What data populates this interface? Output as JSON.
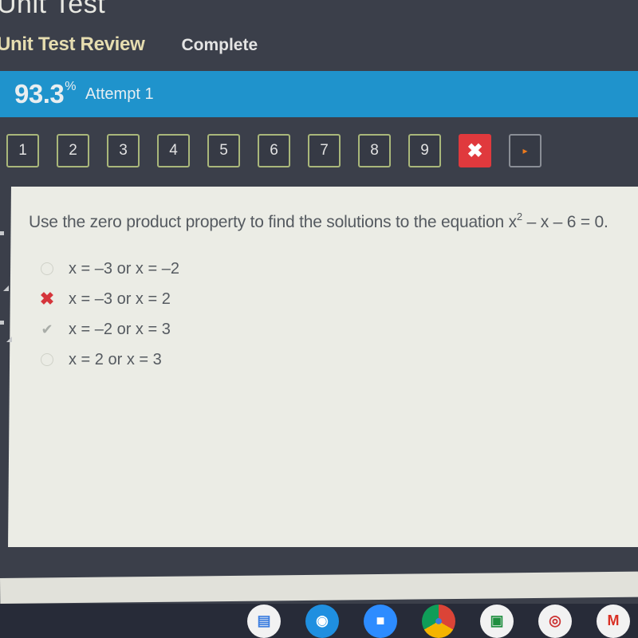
{
  "header": {
    "title": "Unit Test",
    "subnav": {
      "review": "Unit Test Review",
      "status": "Complete"
    }
  },
  "score_bar": {
    "score": "93.3",
    "percent_sign": "%",
    "attempt": "Attempt 1",
    "color": "#1f93cc"
  },
  "question_nav": {
    "items": [
      {
        "label": "1",
        "state": "answered"
      },
      {
        "label": "2",
        "state": "answered"
      },
      {
        "label": "3",
        "state": "answered"
      },
      {
        "label": "4",
        "state": "answered"
      },
      {
        "label": "5",
        "state": "answered"
      },
      {
        "label": "6",
        "state": "answered"
      },
      {
        "label": "7",
        "state": "answered"
      },
      {
        "label": "8",
        "state": "answered"
      },
      {
        "label": "9",
        "state": "answered"
      },
      {
        "label": "✖",
        "state": "incorrect",
        "icon": "x-icon"
      },
      {
        "label": "▸",
        "state": "next",
        "icon": "play-arrow-icon"
      }
    ],
    "answered_border": "#a9b77a",
    "incorrect_color": "#e0393d"
  },
  "question": {
    "prefix": "Use the zero product property to find the solutions to the equation x",
    "exponent": "2",
    "suffix": " – x – 6 = 0.",
    "choices": [
      {
        "text": "x = –3 or x = –2",
        "mark": "radio-icon",
        "glyph": ""
      },
      {
        "text": "x = –3 or x = 2",
        "mark": "x-mark-icon",
        "glyph": "✖"
      },
      {
        "text": "x = –2 or x = 3",
        "mark": "check-icon",
        "glyph": "✔"
      },
      {
        "text": "x = 2 or x = 3",
        "mark": "radio-icon",
        "glyph": ""
      }
    ]
  },
  "shelf": {
    "apps": [
      {
        "name": "google-docs-icon",
        "glyph": "▤",
        "color": "#3b7de0"
      },
      {
        "name": "eye-app-icon",
        "glyph": "◉",
        "color": "#1f8fe0"
      },
      {
        "name": "zoom-icon",
        "glyph": "■",
        "color": "#2d8cff"
      },
      {
        "name": "chrome-icon",
        "glyph": "●",
        "color": "#3a7be0"
      },
      {
        "name": "google-classroom-icon",
        "glyph": "▣",
        "color": "#1e8e3e"
      },
      {
        "name": "screencastify-icon",
        "glyph": "◎",
        "color": "#c33"
      },
      {
        "name": "gmail-icon",
        "glyph": "M",
        "color": "#d93025"
      }
    ]
  }
}
